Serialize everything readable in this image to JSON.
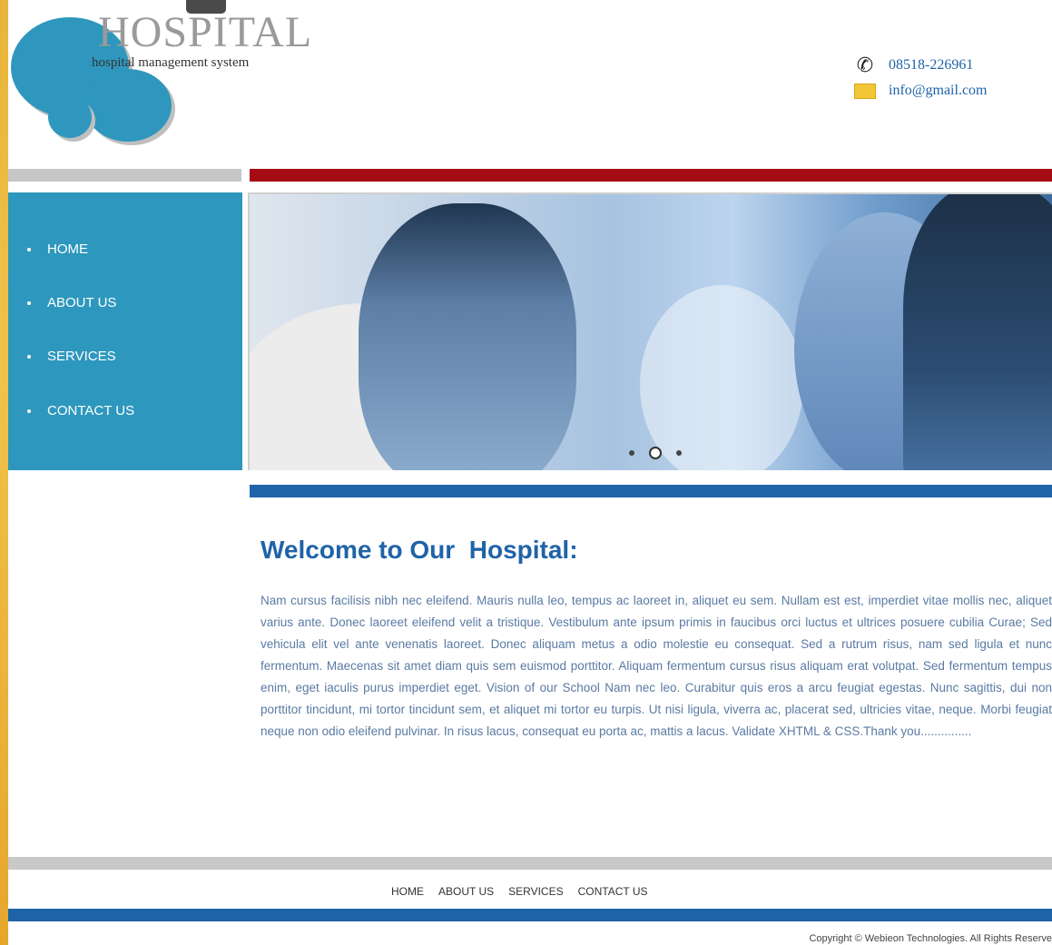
{
  "logo": {
    "title": "HOSPITAL",
    "subtitle": "hospital management system"
  },
  "contact": {
    "phone": "08518-226961",
    "email": "info@gmail.com",
    "phone_icon": "phone-icon",
    "email_icon": "mail-icon"
  },
  "sidebar": {
    "items": [
      {
        "label": "HOME"
      },
      {
        "label": "ABOUT US"
      },
      {
        "label": "SERVICES"
      },
      {
        "label": "CONTACT US"
      }
    ]
  },
  "slider": {
    "active_index": 1,
    "count": 3
  },
  "main": {
    "heading": "Welcome to Our  Hospital:",
    "body": "Nam cursus facilisis nibh nec eleifend. Mauris nulla leo, tempus ac laoreet in, aliquet eu sem. Nullam est est, imperdiet vitae mollis nec, aliquet varius ante. Donec laoreet eleifend velit a tristique. Vestibulum ante ipsum primis in faucibus orci luctus et ultrices posuere cubilia Curae; Sed vehicula elit vel ante venenatis laoreet. Donec aliquam metus a odio molestie eu consequat. Sed a rutrum risus, nam sed ligula et nunc fermentum. Maecenas sit amet diam quis sem euismod porttitor. Aliquam fermentum cursus risus aliquam erat volutpat. Sed fermentum tempus enim, eget iaculis purus imperdiet eget. Vision of our School Nam nec leo. Curabitur quis eros a arcu feugiat egestas. Nunc sagittis, dui non porttitor tincidunt, mi tortor tincidunt sem, et aliquet mi tortor eu turpis. Ut nisi ligula, viverra ac, placerat sed, ultricies vitae, neque. Morbi feugiat neque non odio eleifend pulvinar. In risus lacus, consequat eu porta ac, mattis a lacus. Validate XHTML & CSS.Thank you..............."
  },
  "footer": {
    "nav": [
      "HOME",
      "ABOUT US",
      "SERVICES",
      "CONTACT US"
    ],
    "copyright": "Copyright © Webieon Technologies. All Rights Reserve"
  },
  "colors": {
    "accent_blue": "#1f63a8",
    "sidebar_blue": "#2e97bd",
    "red_bar": "#a50b14",
    "gray_bar": "#c6c6c6",
    "desktop_bg": "#f0c24a"
  }
}
